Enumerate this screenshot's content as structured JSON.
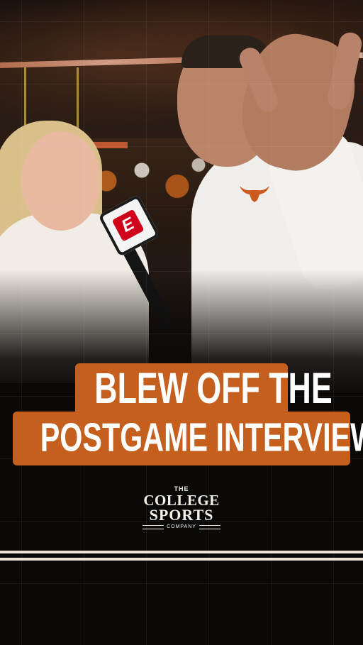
{
  "headline": {
    "line1": "BLEW OFF THE",
    "line2": "POSTGAME INTERVIEW",
    "box_color": "#c45f1e",
    "text_color": "#ffffff"
  },
  "logo": {
    "the": "THE",
    "college": "COLLEGE",
    "sports": "SPORTS",
    "company": "COMPANY"
  },
  "mic_flag": {
    "letter": "E",
    "color": "#d0021b"
  },
  "colors": {
    "background": "#0b0908",
    "stripe": "#ece3d6",
    "accent_orange": "#c45f1e"
  },
  "icons": [
    "espn-mic-flag-icon",
    "longhorn-logo-icon"
  ]
}
